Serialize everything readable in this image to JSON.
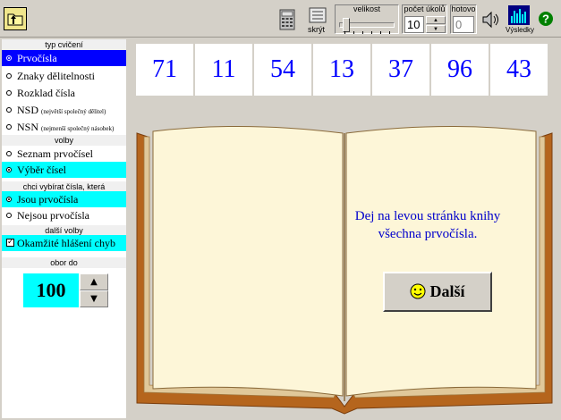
{
  "toolbar": {
    "hide_label": "skrýt",
    "size_label": "velikost",
    "count_label": "počet úkolů",
    "count_value": "10",
    "done_label": "hotovo",
    "done_value": "0",
    "results_label": "Výsledky"
  },
  "sidebar": {
    "exercise_type_header": "typ cvičení",
    "exercise_types": [
      {
        "label": "Prvočísla",
        "selected": true
      },
      {
        "label": "Znaky dělitelnosti",
        "selected": false
      },
      {
        "label": "Rozklad čísla",
        "selected": false
      },
      {
        "label": "NSD",
        "note": "(největší společný dělitel)",
        "selected": false
      },
      {
        "label": "NSN",
        "note": "(nejmenší společný násobek)",
        "selected": false
      }
    ],
    "options_header": "volby",
    "options": [
      {
        "label": "Seznam prvočísel",
        "selected": false
      },
      {
        "label": "Výběr čísel",
        "selected": true
      }
    ],
    "choose_header": "chci vybírat čísla, která",
    "choose": [
      {
        "label": "Jsou prvočísla",
        "selected": true
      },
      {
        "label": "Nejsou prvočísla",
        "selected": false
      }
    ],
    "more_header": "další volby",
    "instant_errors_label": "Okamžité hlášení chyb",
    "instant_errors_checked": "✓",
    "range_header": "obor do",
    "range_value": "100",
    "range_up": "▲",
    "range_down": "▼"
  },
  "main": {
    "numbers": [
      "71",
      "11",
      "54",
      "13",
      "37",
      "96",
      "43"
    ],
    "instruction": "Dej na levou stránku knihy všechna prvočísla.",
    "next_label": "Další"
  },
  "colors": {
    "number_text": "#0000ff",
    "selected_primary": "#0000ff",
    "selected_secondary": "#00ffff",
    "book_cover": "#b5651d",
    "page": "#fdf6d8"
  }
}
